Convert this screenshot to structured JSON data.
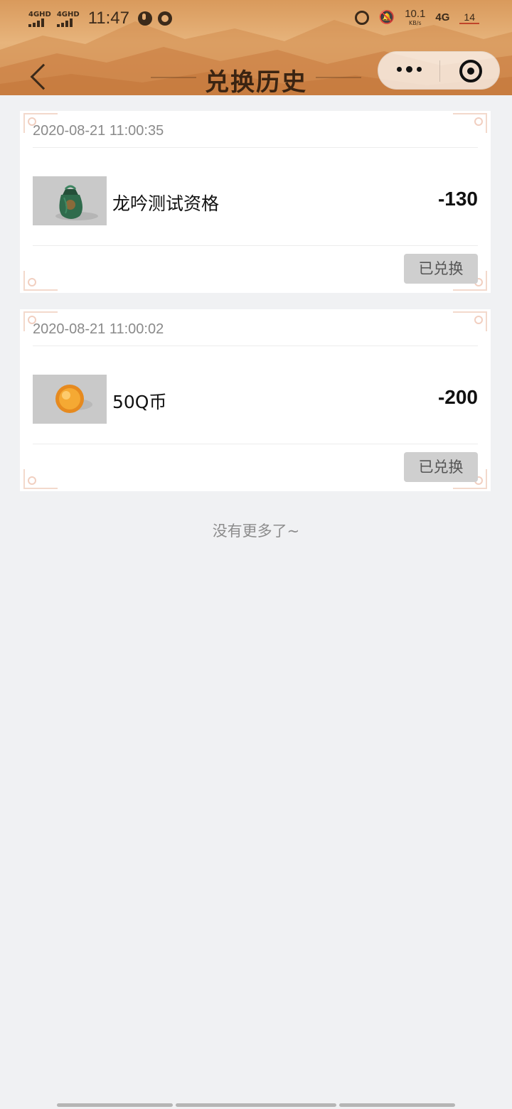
{
  "status_bar": {
    "network_1": "4GHD",
    "network_2": "4GHD",
    "time": "11:47",
    "speed_value": "10.1",
    "speed_unit": "KB/s",
    "network_type": "4G",
    "battery": "14"
  },
  "header": {
    "title": "兑换历史"
  },
  "records": [
    {
      "date": "2020-08-21 11:00:35",
      "item_name": "龙吟测试资格",
      "points": "-130",
      "status": "已兑换",
      "icon": "green-pouch-icon"
    },
    {
      "date": "2020-08-21 11:00:02",
      "item_name": "50Q币",
      "points": "-200",
      "status": "已兑换",
      "icon": "gold-coin-icon"
    }
  ],
  "footer": {
    "no_more_text": "没有更多了~"
  }
}
